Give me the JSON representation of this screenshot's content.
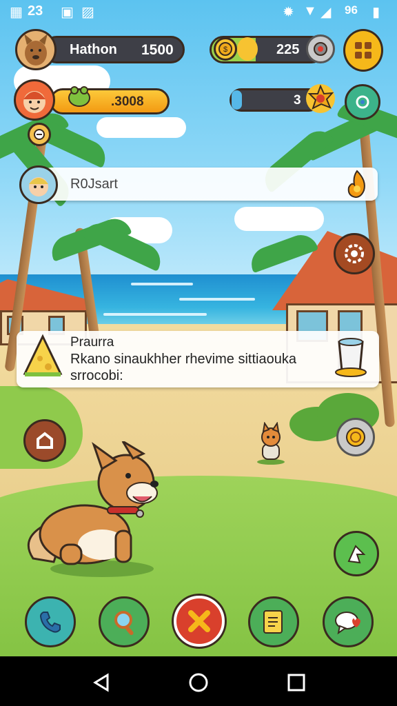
{
  "status_bar": {
    "left_text": "23",
    "right_text": "96"
  },
  "player": {
    "name": "Hathon",
    "score": "1500"
  },
  "companion": {
    "amount": ".3008"
  },
  "currency": {
    "amount": "225"
  },
  "progress": {
    "value": "3",
    "fraction": 0.12
  },
  "notification": {
    "text": "R0Jsart"
  },
  "dialog": {
    "title": "Praurra",
    "line1": "Rkano sinaukhher rhevime sittiaouka",
    "line2": "srrocobi:"
  },
  "colors": {
    "accent_yellow": "#f6b81a",
    "button_green": "#5cbf4e",
    "button_red": "#d9402c"
  },
  "icons": {
    "nav_back": "triangle-back",
    "nav_home": "circle-home",
    "nav_recents": "square-recents",
    "bottom": [
      "phone",
      "magnifier",
      "close",
      "note",
      "chat"
    ]
  }
}
